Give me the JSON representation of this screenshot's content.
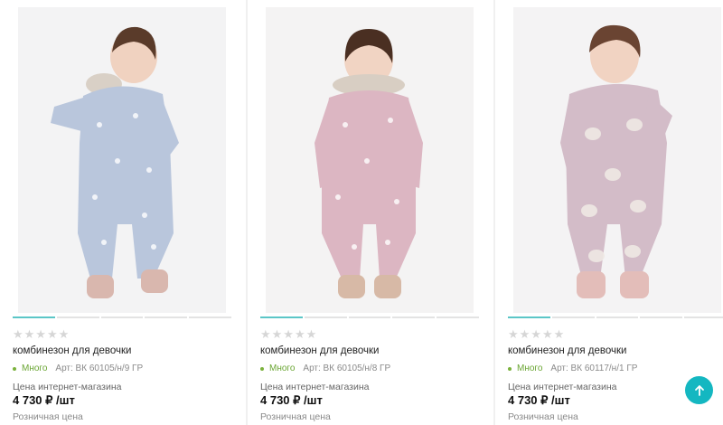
{
  "products": [
    {
      "title": "комбинезон для девочки",
      "stock": "Много",
      "article": "Арт: ВК 60105/н/9 ГР",
      "price_label": "Цена интернет-магазина",
      "price": "4 730 ₽ /шт",
      "retail_label": "Розничная цена",
      "rating_stars": "★★★★★",
      "rating": 0,
      "gallery_active_index": 0,
      "photo_color": "#b9c6dc"
    },
    {
      "title": "комбинезон для девочки",
      "stock": "Много",
      "article": "Арт: ВК 60105/н/8 ГР",
      "price_label": "Цена интернет-магазина",
      "price": "4 730 ₽ /шт",
      "retail_label": "Розничная цена",
      "rating_stars": "★★★★★",
      "rating": 0,
      "gallery_active_index": 0,
      "photo_color": "#dcb6c2"
    },
    {
      "title": "комбинезон для девочки",
      "stock": "Много",
      "article": "Арт: ВК 60117/н/1 ГР",
      "price_label": "Цена интернет-магазина",
      "price": "4 730 ₽ /шт",
      "retail_label": "Розничная цена",
      "rating_stars": "★★★★★",
      "rating": 0,
      "gallery_active_index": 0,
      "photo_color": "#d3bcc8"
    }
  ],
  "colors": {
    "accent": "#14b7c1",
    "gallery_active": "#5bc6c7",
    "in_stock": "#6aa533",
    "stars_empty": "#d6d6d6"
  },
  "scroll_top_icon": "arrow-up-icon"
}
